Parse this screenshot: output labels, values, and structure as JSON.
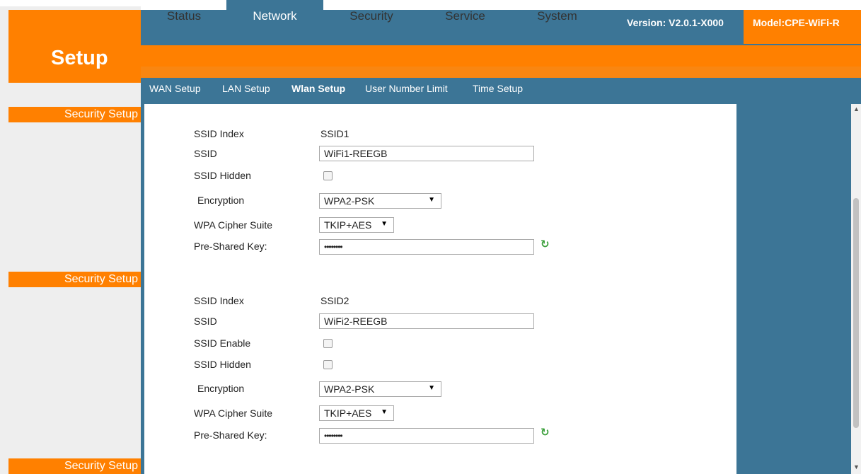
{
  "header": {
    "logo_label": "Setup",
    "version": "Version: V2.0.1-X000",
    "model": "Model:CPE-WiFi-R"
  },
  "tabs": [
    {
      "label": "Status",
      "active": false
    },
    {
      "label": "Network",
      "active": true
    },
    {
      "label": "Security",
      "active": false
    },
    {
      "label": "Service",
      "active": false
    },
    {
      "label": "System",
      "active": false
    }
  ],
  "subnav": [
    {
      "label": "WAN Setup",
      "active": false
    },
    {
      "label": "LAN Setup",
      "active": false
    },
    {
      "label": "Wlan Setup",
      "active": true
    },
    {
      "label": "User Number Limit",
      "active": false
    },
    {
      "label": "Time Setup",
      "active": false
    }
  ],
  "sidebar": {
    "items": [
      {
        "label": "Security Setup"
      },
      {
        "label": "Security Setup"
      },
      {
        "label": "Security Setup"
      }
    ]
  },
  "ssid1": {
    "index_label": "SSID Index",
    "index_value": "SSID1",
    "ssid_label": "SSID",
    "ssid_value": "WiFi1-REEGB",
    "hidden_label": "SSID Hidden",
    "hidden_checked": false,
    "encryption_label": "Encryption",
    "encryption_value": "WPA2-PSK",
    "cipher_label": "WPA Cipher Suite",
    "cipher_value": "TKIP+AES",
    "psk_label": "Pre-Shared Key:",
    "psk_value": "••••••••"
  },
  "ssid2": {
    "index_label": "SSID Index",
    "index_value": "SSID2",
    "ssid_label": "SSID",
    "ssid_value": "WiFi2-REEGB",
    "enable_label": "SSID Enable",
    "enable_checked": false,
    "hidden_label": "SSID Hidden",
    "hidden_checked": false,
    "encryption_label": "Encryption",
    "encryption_value": "WPA2-PSK",
    "cipher_label": "WPA Cipher Suite",
    "cipher_value": "TKIP+AES",
    "psk_label": "Pre-Shared Key:",
    "psk_value": "••••••••"
  },
  "icons": {
    "refresh": "refresh-icon",
    "dropdown": "chevron-down-icon"
  },
  "colors": {
    "brand_orange": "#ff8000",
    "header_blue": "#3c7596"
  }
}
